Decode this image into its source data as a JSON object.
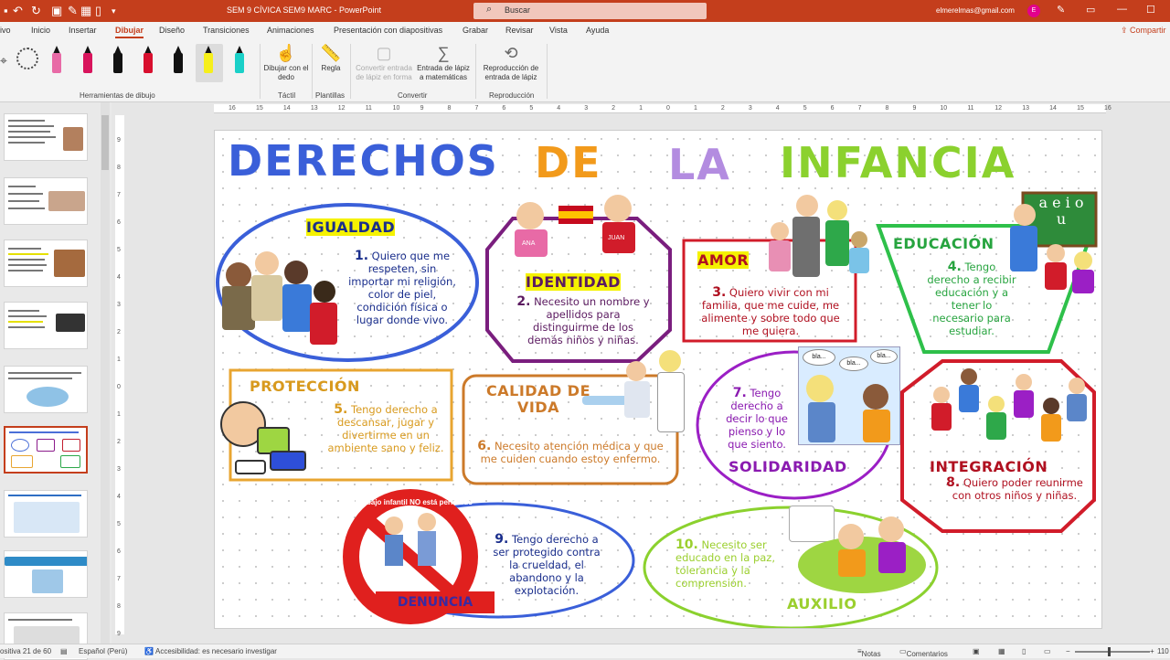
{
  "app": {
    "window_title": "SEM 9 CÍVICA SEM9  MARC  -  PowerPoint",
    "search_placeholder": "Buscar",
    "user_email": "elmerelmas@gmail.com",
    "avatar_initial": "E",
    "share_label": "Compartir",
    "accent_color": "#c43e1c"
  },
  "ribbon_tabs": [
    {
      "label": "ivo"
    },
    {
      "label": "Inicio"
    },
    {
      "label": "Insertar"
    },
    {
      "label": "Dibujar"
    },
    {
      "label": "Diseño"
    },
    {
      "label": "Transiciones"
    },
    {
      "label": "Animaciones"
    },
    {
      "label": "Presentación con diapositivas"
    },
    {
      "label": "Grabar"
    },
    {
      "label": "Revisar"
    },
    {
      "label": "Vista"
    },
    {
      "label": "Ayuda"
    }
  ],
  "ribbon": {
    "pen_colors": [
      "#e86aa6",
      "#d8145c",
      "#111111",
      "#d80f2e",
      "#111111",
      "#f6ef1a",
      "#1ad0c8"
    ],
    "buttons": {
      "touch": "Dibujar con el dedo",
      "ruler": "Regla",
      "ink_to_shape": "Convertir entrada de lápiz en forma",
      "ink_to_math": "Entrada de lápiz a matemáticas",
      "ink_replay": "Reproducción de entrada de lápiz"
    },
    "groups": {
      "drawing_tools": "Herramientas de dibujo",
      "touch": "Táctil",
      "stencils": "Plantillas",
      "convert": "Convertir",
      "replay": "Reproducción"
    }
  },
  "rulers": {
    "h_ticks": [
      "16",
      "15",
      "14",
      "13",
      "12",
      "11",
      "10",
      "9",
      "8",
      "7",
      "6",
      "5",
      "4",
      "3",
      "2",
      "1",
      "0",
      "1",
      "2",
      "3",
      "4",
      "5",
      "6",
      "7",
      "8",
      "9",
      "10",
      "11",
      "12",
      "13",
      "14",
      "15",
      "16"
    ],
    "v_ticks": [
      "9",
      "8",
      "7",
      "6",
      "5",
      "4",
      "3",
      "2",
      "1",
      "0",
      "1",
      "2",
      "3",
      "4",
      "5",
      "6",
      "7",
      "8",
      "9"
    ]
  },
  "slide": {
    "title": {
      "w1": "DERECHOS",
      "w2": "DE",
      "w3": "LA",
      "w4": "INFANCIA"
    },
    "sections": {
      "igualdad": {
        "heading": "IGUALDAD",
        "num": "1.",
        "text": "Quiero que me respeten, sin importar mi religión, color de piel, condición física o lugar donde vivo."
      },
      "identidad": {
        "heading": "IDENTIDAD",
        "num": "2.",
        "text": "Necesito un nombre y apellidos para distinguirme de los demás niños y niñas.",
        "sign1": "ANA",
        "sign2": "JUAN"
      },
      "amor": {
        "heading": "AMOR",
        "num": "3.",
        "text": "Quiero vivir con mi familia, que me cuide, me alimente y sobre todo que me quiera."
      },
      "educacion": {
        "heading": "EDUCACIÓN",
        "num": "4.",
        "text": "Tengo derecho a recibir educación y a tener lo necesario para estudiar.",
        "board": "a e i o u"
      },
      "proteccion": {
        "heading": "PROTECCIÓN",
        "num": "5.",
        "text": "Tengo derecho a descansar, jugar y divertirme en un ambiente sano y feliz."
      },
      "calidad": {
        "heading": "CALIDAD DE VIDA",
        "num": "6.",
        "text": "Necesito atención médica y que me cuiden cuando estoy enfermo."
      },
      "solidaridad": {
        "heading": "SOLIDARIDAD",
        "num": "7.",
        "text": "Tengo derecho a decir lo que pienso y lo que siento.",
        "bubble1": "bla...",
        "bubble2": "bla...",
        "bubble3": "bla..."
      },
      "integracion": {
        "heading": "INTEGRACIÓN",
        "num": "8.",
        "text": "Quiero poder reunirme con otros niños y niñas."
      },
      "denuncia": {
        "num": "9.",
        "text": "Tengo derecho a ser protegido contra la crueldad, el abandono y la explotación.",
        "sign_banner": "DENUNCIA",
        "ring_text": "El trabajo infantil NO está permitido"
      },
      "auxilio": {
        "heading": "AUXILIO",
        "num": "10.",
        "text": "Necesito ser educado en la paz, tolerancia y la comprensión."
      }
    }
  },
  "status_bar": {
    "slide_counter": "ositiva 21 de 60",
    "language": "Español (Perú)",
    "accessibility": "Accesibilidad: es necesario investigar",
    "notes": "Notas",
    "comments": "Comentarios",
    "zoom": "110"
  }
}
